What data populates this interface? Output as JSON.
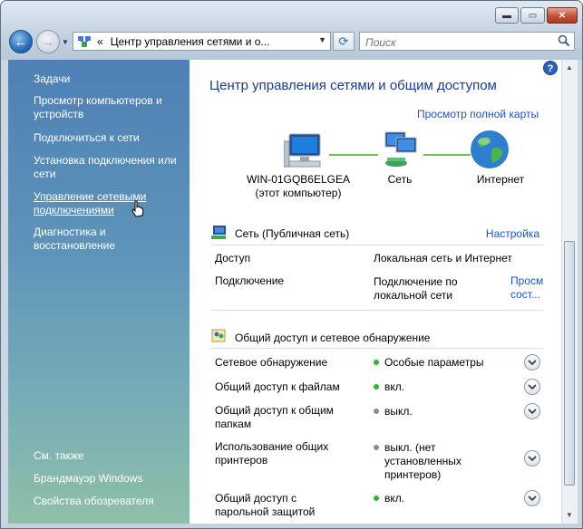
{
  "address": {
    "breadcrumb_sep": "«",
    "path": "Центр управления сетями и о..."
  },
  "search": {
    "placeholder": "Поиск"
  },
  "sidebar": {
    "tasks_heading": "Задачи",
    "tasks": [
      "Просмотр компьютеров и устройств",
      "Подключиться к сети",
      "Установка подключения или сети",
      "Управление сетевыми подключениями",
      "Диагностика и восстановление"
    ],
    "see_also_heading": "См. также",
    "see_also": [
      "Брандмауэр Windows",
      "Свойства обозревателя"
    ]
  },
  "main": {
    "title": "Центр управления сетями и общим доступом",
    "full_map_link": "Просмотр полной карты",
    "map": {
      "computer_name": "WIN-01GQB6ELGEA",
      "computer_sub": "(этот компьютер)",
      "network_label": "Сеть",
      "internet_label": "Интернет"
    },
    "network": {
      "name": "Сеть (Публичная сеть)",
      "customize_link": "Настройка",
      "rows": [
        {
          "label": "Доступ",
          "value": "Локальная сеть и Интернет"
        },
        {
          "label": "Подключение",
          "value": "Подключение по локальной сети",
          "link1": "Просм",
          "link2": "сост..."
        }
      ]
    },
    "sharing": {
      "heading": "Общий доступ и сетевое обнаружение",
      "rows": [
        {
          "label": "Сетевое обнаружение",
          "status": "Особые параметры",
          "color": "#2fb52f"
        },
        {
          "label": "Общий доступ к файлам",
          "status": "вкл.",
          "color": "#2fb52f"
        },
        {
          "label": "Общий доступ к общим папкам",
          "status": "выкл.",
          "color": "#8c8c8c"
        },
        {
          "label": "Использование общих принтеров",
          "status": "выкл. (нет установленных принтеров)",
          "color": "#8c8c8c"
        },
        {
          "label": "Общий доступ с парольной защитой",
          "status": "вкл.",
          "color": "#2fb52f"
        }
      ]
    }
  },
  "icons": [
    "back-icon",
    "forward-icon",
    "network-folder-icon",
    "refresh-icon",
    "search-icon",
    "help-icon",
    "computer-icon",
    "network-icon",
    "globe-icon",
    "network-small-icon",
    "sharing-icon",
    "chevron-down-icon"
  ]
}
